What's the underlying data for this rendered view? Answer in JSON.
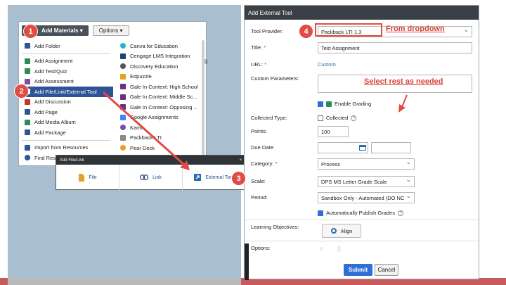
{
  "materials": {
    "add_materials_label": "Add Materials",
    "options_label": "Options",
    "col1": [
      {
        "label": "Add Folder",
        "icon": "folder-icon",
        "color": "#2f5496"
      },
      {
        "label": "Add Assignment",
        "icon": "assignment-icon",
        "color": "#2e8b57"
      },
      {
        "label": "Add Test/Quiz",
        "icon": "quiz-icon",
        "color": "#2e8b57"
      },
      {
        "label": "Add Assessment",
        "icon": "assessment-icon",
        "color": "#7b4fa6"
      },
      {
        "label": "Add File/Link/External Tool",
        "icon": "file-link-icon",
        "color": "#ffffff"
      },
      {
        "label": "Add Discussion",
        "icon": "discussion-icon",
        "color": "#c0392b"
      },
      {
        "label": "Add Page",
        "icon": "page-icon",
        "color": "#2f5496"
      },
      {
        "label": "Add Media Album",
        "icon": "media-album-icon",
        "color": "#2e8b57"
      },
      {
        "label": "Add Package",
        "icon": "package-icon",
        "color": "#2f5496"
      },
      {
        "label": "Import from Resources",
        "icon": "import-icon",
        "color": "#2f5496"
      },
      {
        "label": "Find Res",
        "icon": "search-icon",
        "color": "#2f5496"
      }
    ],
    "col2": [
      {
        "label": "Canva for Education",
        "icon": "canva-icon",
        "color": "#1fb6c9"
      },
      {
        "label": "Cengage LMS Integration",
        "icon": "cengage-icon",
        "color": "#1f3f77"
      },
      {
        "label": "Discovery Education",
        "icon": "discovery-icon",
        "color": "#555555"
      },
      {
        "label": "Edpuzzle",
        "icon": "edpuzzle-icon",
        "color": "#e8a020"
      },
      {
        "label": "Gale In Context: High School",
        "icon": "gale-icon",
        "color": "#6b2f8a"
      },
      {
        "label": "Gale In Context: Middle Sc...",
        "icon": "gale-icon",
        "color": "#6b2f8a"
      },
      {
        "label": "Gale In Context: Opposing ...",
        "icon": "gale-icon",
        "color": "#6b2f8a"
      },
      {
        "label": "Google Assignments",
        "icon": "google-icon",
        "color": "#4285f4"
      },
      {
        "label": "Kami",
        "icon": "kami-icon",
        "color": "#7b4fa6"
      },
      {
        "label": "Packback LTI",
        "icon": "packback-icon",
        "color": "#888888"
      },
      {
        "label": "Pear Deck",
        "icon": "pear-deck-icon",
        "color": "#e8a020"
      }
    ],
    "shadow_text": "g"
  },
  "filelink": {
    "title": "Add File/Link",
    "close": "×",
    "options": [
      {
        "label": "File",
        "icon": "file-icon"
      },
      {
        "label": "Link",
        "icon": "link-icon"
      },
      {
        "label": "External Tool",
        "icon": "external-tool-icon"
      }
    ]
  },
  "form": {
    "title": "Add External Tool",
    "tool_provider_label": "Tool Provider:",
    "tool_provider_value": "Packback LTI 1.3",
    "title_label": "Title:",
    "title_value": "Test Assignment",
    "url_label": "URL:",
    "url_value": "Custom",
    "custom_params_label": "Custom Parameters:",
    "enable_grading_label": "Enable Grading",
    "collected_type_label": "Collected Type:",
    "collected_label": "Collected",
    "points_label": "Points:",
    "points_value": "100",
    "due_date_label": "Due Date:",
    "category_label": "Category:",
    "category_value": "Process",
    "scale_label": "Scale:",
    "scale_value": "DPS MS Letter Grade Scale",
    "period_label": "Period:",
    "period_value": "Sandbox Only - Automated (DO NC",
    "auto_publish_label": "Automatically Publish Grades",
    "learning_objectives_label": "Learning Objectives:",
    "align_label": "Align",
    "options_label": "Options:",
    "submit_label": "Submit",
    "cancel_label": "Cancel",
    "required_mark": "*"
  },
  "annotations": {
    "step1": "1",
    "step2": "2",
    "step3": "3",
    "step4": "4",
    "from_dropdown": "From dropdown",
    "select_rest": "Select rest as needed",
    "accent_color": "#e04b43"
  }
}
